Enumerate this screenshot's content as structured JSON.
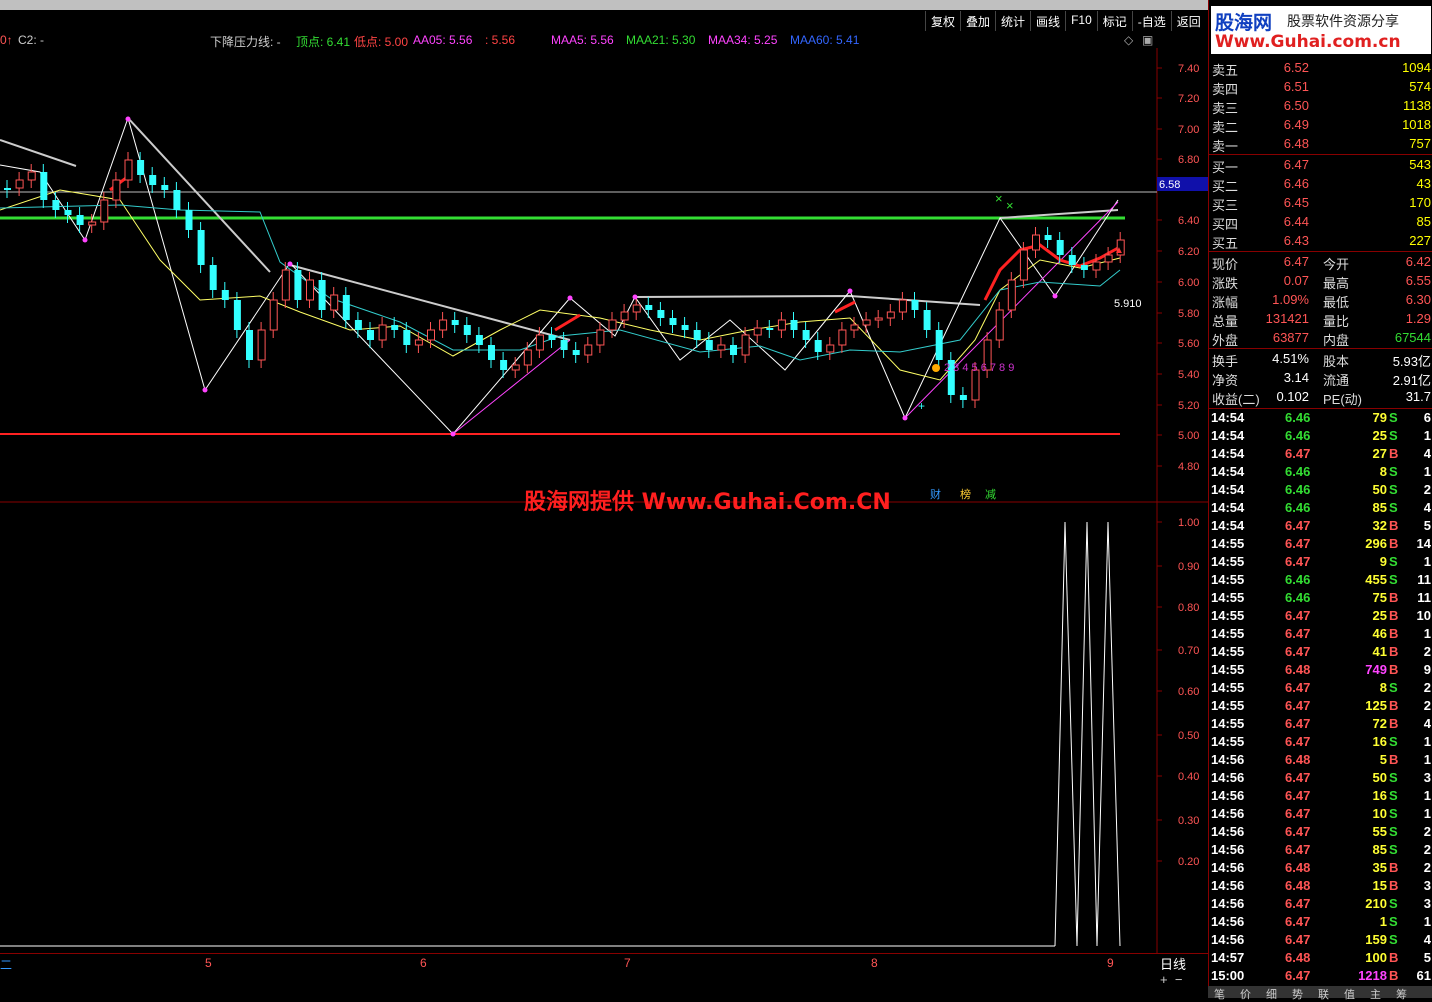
{
  "toolbar": [
    "复权",
    "叠加",
    "统计",
    "画线",
    "F10",
    "标记",
    "-自选",
    "返回"
  ],
  "legend": {
    "c2": "C2: -",
    "pressure": "下降压力线: -",
    "top": "顶点: 6.41",
    "bottom": "低点: 5.00",
    "aa05": "AA05: 5.56",
    "aa05b": ": 5.56",
    "maa5": "MAA5: 5.56",
    "maa21": "MAA21: 5.30",
    "maa34": "MAA34: 5.25",
    "maa60": "MAA60: 5.41"
  },
  "price_axis": [
    "7.40",
    "7.20",
    "7.00",
    "6.80",
    "6.58",
    "6.40",
    "6.20",
    "6.00",
    "5.80",
    "5.60",
    "5.40",
    "5.20",
    "5.00",
    "4.80"
  ],
  "indicator_axis": [
    "1.00",
    "0.90",
    "0.80",
    "0.70",
    "0.60",
    "0.50",
    "0.40",
    "0.30",
    "0.20"
  ],
  "price_marker": "6.58",
  "low_label": "5.910",
  "count_label": "2 3 4 5 6 7 8 9",
  "badges": [
    "财",
    "榜",
    "减"
  ],
  "watermark": "股海网提供 Www.Guhai.Com.CN",
  "x_labels": [
    "5",
    "6",
    "7",
    "8",
    "9"
  ],
  "period": "日线",
  "logo": {
    "brand": "股海网",
    "slogan": "股票软件资源分享",
    "url": "Www.Guhai.com.cn"
  },
  "sell": [
    {
      "label": "卖五",
      "price": "6.52",
      "vol": "1094"
    },
    {
      "label": "卖四",
      "price": "6.51",
      "vol": "574"
    },
    {
      "label": "卖三",
      "price": "6.50",
      "vol": "1138"
    },
    {
      "label": "卖二",
      "price": "6.49",
      "vol": "1018"
    },
    {
      "label": "卖一",
      "price": "6.48",
      "vol": "757"
    }
  ],
  "buy": [
    {
      "label": "买一",
      "price": "6.47",
      "vol": "543"
    },
    {
      "label": "买二",
      "price": "6.46",
      "vol": "43"
    },
    {
      "label": "买三",
      "price": "6.45",
      "vol": "170"
    },
    {
      "label": "买四",
      "price": "6.44",
      "vol": "85"
    },
    {
      "label": "买五",
      "price": "6.43",
      "vol": "227"
    }
  ],
  "stats": [
    {
      "l1": "现价",
      "v1": "6.47",
      "l2": "今开",
      "v2": "6.42"
    },
    {
      "l1": "涨跌",
      "v1": "0.07",
      "l2": "最高",
      "v2": "6.55"
    },
    {
      "l1": "涨幅",
      "v1": "1.09%",
      "l2": "最低",
      "v2": "6.30"
    },
    {
      "l1": "总量",
      "v1": "131421",
      "l2": "量比",
      "v2": "1.29"
    },
    {
      "l1": "外盘",
      "v1": "63877",
      "l2": "内盘",
      "v2": "67544"
    }
  ],
  "stats2": [
    {
      "l1": "换手",
      "v1": "4.51%",
      "l2": "股本",
      "v2": "5.93亿"
    },
    {
      "l1": "净资",
      "v1": "3.14",
      "l2": "流通",
      "v2": "2.91亿"
    },
    {
      "l1": "收益(二)",
      "v1": "0.102",
      "l2": "PE(动)",
      "v2": "31.7"
    }
  ],
  "ticks": [
    [
      "14:54",
      "6.46",
      "79",
      "S",
      "6"
    ],
    [
      "14:54",
      "6.46",
      "25",
      "S",
      "1"
    ],
    [
      "14:54",
      "6.47",
      "27",
      "B",
      "4"
    ],
    [
      "14:54",
      "6.46",
      "8",
      "S",
      "1"
    ],
    [
      "14:54",
      "6.46",
      "50",
      "S",
      "2"
    ],
    [
      "14:54",
      "6.46",
      "85",
      "S",
      "4"
    ],
    [
      "14:54",
      "6.47",
      "32",
      "B",
      "5"
    ],
    [
      "14:55",
      "6.47",
      "296",
      "B",
      "14"
    ],
    [
      "14:55",
      "6.47",
      "9",
      "S",
      "1"
    ],
    [
      "14:55",
      "6.46",
      "455",
      "S",
      "11"
    ],
    [
      "14:55",
      "6.46",
      "75",
      "B",
      "11"
    ],
    [
      "14:55",
      "6.47",
      "25",
      "B",
      "10"
    ],
    [
      "14:55",
      "6.47",
      "46",
      "B",
      "1"
    ],
    [
      "14:55",
      "6.47",
      "41",
      "B",
      "2"
    ],
    [
      "14:55",
      "6.48",
      "749",
      "B",
      "9"
    ],
    [
      "14:55",
      "6.47",
      "8",
      "S",
      "2"
    ],
    [
      "14:55",
      "6.47",
      "125",
      "B",
      "2"
    ],
    [
      "14:55",
      "6.47",
      "72",
      "B",
      "4"
    ],
    [
      "14:55",
      "6.47",
      "16",
      "S",
      "1"
    ],
    [
      "14:56",
      "6.48",
      "5",
      "B",
      "1"
    ],
    [
      "14:56",
      "6.47",
      "50",
      "S",
      "3"
    ],
    [
      "14:56",
      "6.47",
      "16",
      "S",
      "1"
    ],
    [
      "14:56",
      "6.47",
      "10",
      "S",
      "1"
    ],
    [
      "14:56",
      "6.47",
      "55",
      "S",
      "2"
    ],
    [
      "14:56",
      "6.47",
      "85",
      "S",
      "2"
    ],
    [
      "14:56",
      "6.48",
      "35",
      "B",
      "2"
    ],
    [
      "14:56",
      "6.48",
      "15",
      "B",
      "3"
    ],
    [
      "14:56",
      "6.47",
      "210",
      "S",
      "3"
    ],
    [
      "14:56",
      "6.47",
      "1",
      "S",
      "1"
    ],
    [
      "14:56",
      "6.47",
      "159",
      "S",
      "4"
    ],
    [
      "14:57",
      "6.48",
      "100",
      "B",
      "5"
    ],
    [
      "15:00",
      "6.47",
      "1218",
      "B",
      "61"
    ]
  ],
  "bottom_tabs": [
    "笔",
    "价",
    "细",
    "势",
    "联",
    "值",
    "主",
    "筹"
  ],
  "colors": {
    "up": "#ff5555",
    "down": "#33ffff",
    "grid": "#880000",
    "green_line": "#33dd33",
    "red_line": "#ff2222"
  }
}
